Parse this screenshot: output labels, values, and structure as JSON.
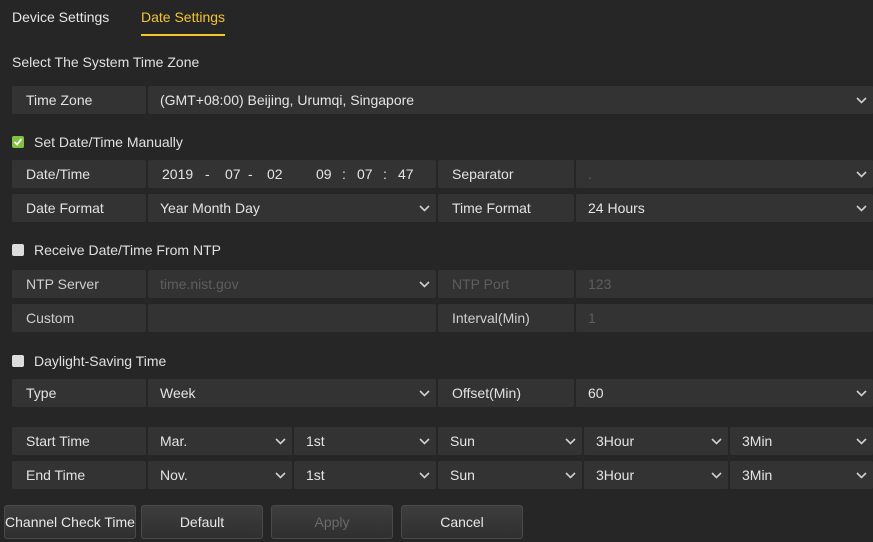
{
  "tabs": [
    {
      "label": "Device Settings"
    },
    {
      "label": "Date Settings"
    }
  ],
  "timezone_section_title": "Select The System Time Zone",
  "timezone": {
    "label": "Time Zone",
    "value": "(GMT+08:00) Beijing, Urumqi, Singapore"
  },
  "manual": {
    "checkbox_label": "Set Date/Time Manually",
    "checked": true,
    "datetime_label": "Date/Time",
    "year": "2019",
    "month": "07",
    "day": "02",
    "date_sep": "-",
    "hour": "09",
    "minute": "07",
    "second": "47",
    "time_sep": ":",
    "separator_label": "Separator",
    "separator_value": ".",
    "date_format_label": "Date Format",
    "date_format_value": "Year Month Day",
    "time_format_label": "Time Format",
    "time_format_value": "24 Hours"
  },
  "ntp": {
    "checkbox_label": "Receive Date/Time From NTP",
    "checked": false,
    "server_label": "NTP Server",
    "server_value": "time.nist.gov",
    "port_label": "NTP Port",
    "port_value": "123",
    "custom_label": "Custom",
    "custom_value": "",
    "interval_label": "Interval(Min)",
    "interval_value": "1"
  },
  "dst": {
    "checkbox_label": "Daylight-Saving Time",
    "checked": false,
    "type_label": "Type",
    "type_value": "Week",
    "offset_label": "Offset(Min)",
    "offset_value": "60",
    "start": {
      "label": "Start Time",
      "month": "Mar.",
      "week": "1st",
      "day": "Sun",
      "hour": "3Hour",
      "minute": "3Min"
    },
    "end": {
      "label": "End Time",
      "month": "Nov.",
      "week": "1st",
      "day": "Sun",
      "hour": "3Hour",
      "minute": "3Min"
    }
  },
  "buttons": {
    "channel_check": "Channel Check Time",
    "default": "Default",
    "apply": "Apply",
    "cancel": "Cancel"
  },
  "colors": {
    "accent": "#f3c531",
    "check_green": "#7fc242",
    "cell_bg": "#333333",
    "page_bg": "#262626"
  },
  "icons": {
    "dropdown": "chevron-down-icon",
    "checkbox": "checkmark-icon"
  }
}
